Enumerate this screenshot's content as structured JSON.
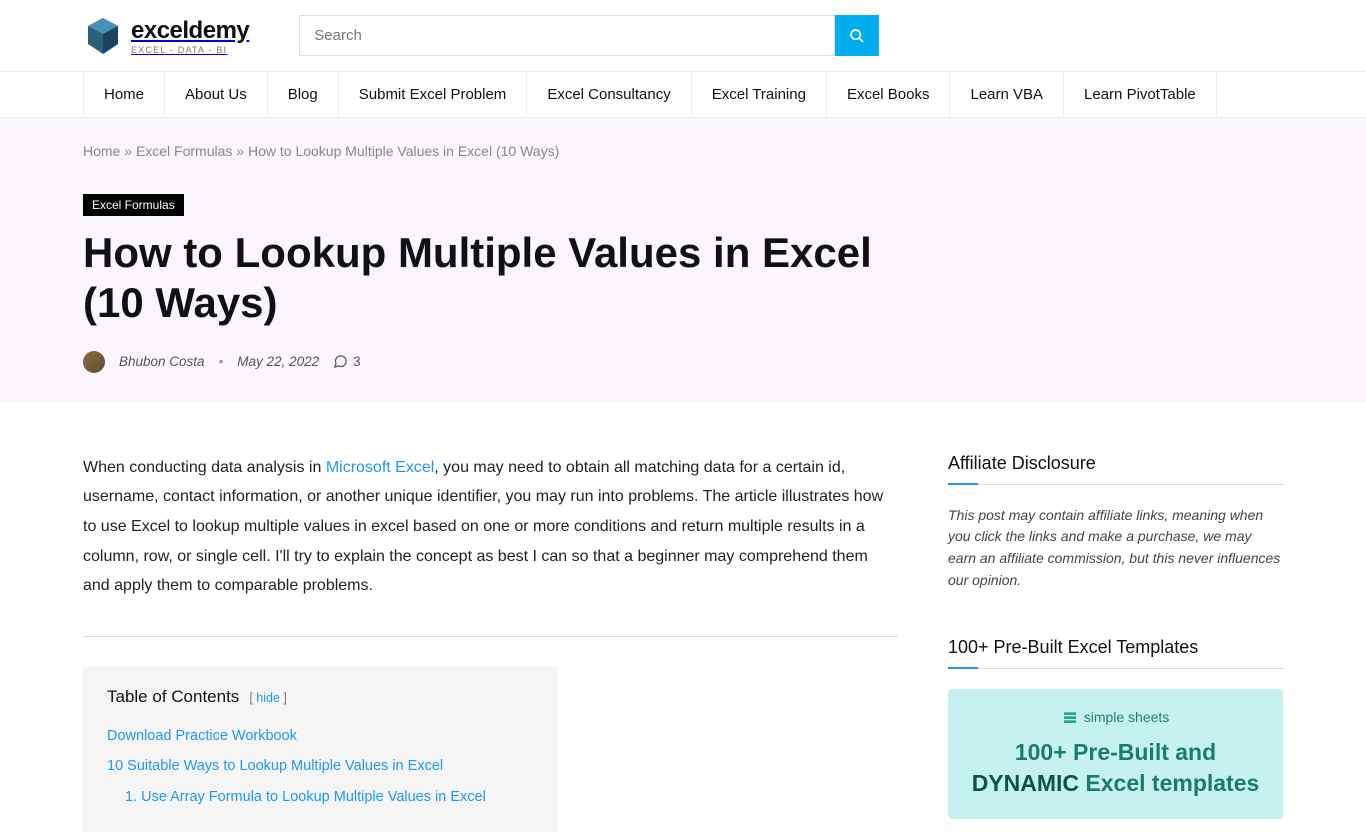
{
  "logo": {
    "title": "exceldemy",
    "subtitle": "EXCEL - DATA - BI"
  },
  "search": {
    "placeholder": "Search"
  },
  "nav": {
    "items": [
      "Home",
      "About Us",
      "Blog",
      "Submit Excel Problem",
      "Excel Consultancy",
      "Excel Training",
      "Excel Books",
      "Learn VBA",
      "Learn PivotTable"
    ]
  },
  "breadcrumb": {
    "home": "Home",
    "sep": " » ",
    "category": "Excel Formulas",
    "current": "How to Lookup Multiple Values in Excel (10 Ways)"
  },
  "post": {
    "category": "Excel Formulas",
    "title": "How to Lookup Multiple Values in Excel (10 Ways)",
    "author": "Bhubon Costa",
    "date": "May 22, 2022",
    "comments": "3"
  },
  "intro": {
    "pre": "When conducting data analysis in ",
    "link": "Microsoft Excel",
    "post": ", you may need to obtain all matching data for a certain id, username, contact information, or another unique identifier, you may run into problems. The article illustrates how to use Excel to lookup multiple values in excel based on one or more conditions and return multiple results in a column, row, or single cell. I'll try to explain the concept as best I can so that a beginner may comprehend them and apply them to comparable problems."
  },
  "toc": {
    "title": "Table of Contents",
    "hide": "hide",
    "items": [
      "Download Practice Workbook",
      "10 Suitable Ways to Lookup Multiple Values in Excel"
    ],
    "sub": "1. Use Array Formula to Lookup Multiple Values in Excel"
  },
  "sidebar": {
    "affiliate_title": "Affiliate Disclosure",
    "affiliate_text": "This post may contain affiliate links, meaning when you click the links and make a purchase, we may earn an affiliate commission, but this never influences our opinion.",
    "templates_title": "100+ Pre-Built Excel Templates",
    "promo_brand": "simple sheets",
    "promo_line1": "100+ Pre-Built ",
    "promo_and": "and",
    "promo_line2a": "DYNAMIC",
    "promo_line2b": " Excel templates"
  }
}
